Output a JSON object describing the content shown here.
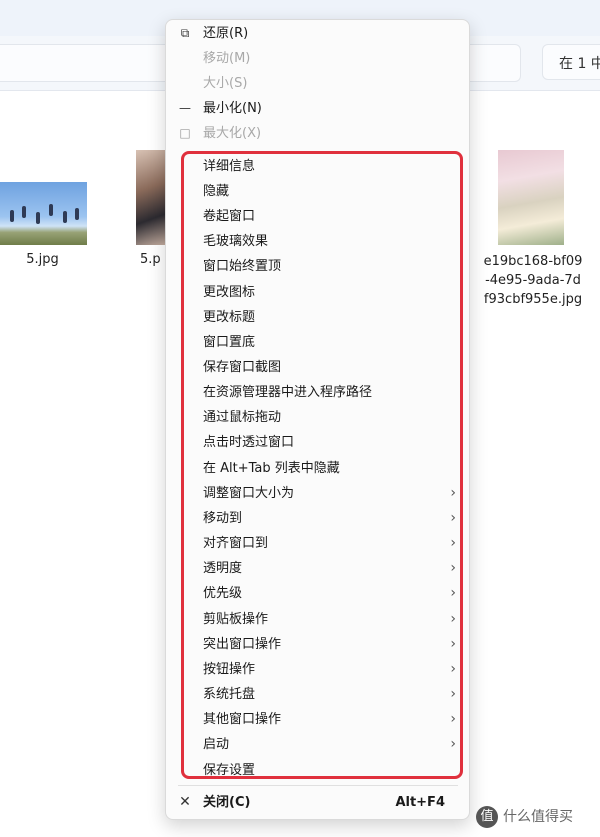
{
  "search": {
    "text": "在 1 中"
  },
  "files": [
    {
      "name": "5.jpg"
    },
    {
      "name": "5.p"
    },
    {
      "name": "e19bc168-bf09-4e95-9ada-7df93cbf955e.jpg",
      "lines": [
        "e19bc168-bf09",
        "-4e95-9ada-7d",
        "f93cbf955e.jpg"
      ]
    }
  ],
  "menu": {
    "system_items": [
      {
        "label": "还原(R)",
        "icon": "restore-icon",
        "disabled": false
      },
      {
        "label": "移动(M)",
        "disabled": true
      },
      {
        "label": "大小(S)",
        "disabled": true
      },
      {
        "label": "最小化(N)",
        "icon": "minimize-icon",
        "disabled": false
      },
      {
        "label": "最大化(X)",
        "icon": "maximize-icon",
        "disabled": true
      }
    ],
    "custom_items": [
      {
        "label": "详细信息"
      },
      {
        "label": "隐藏"
      },
      {
        "label": "卷起窗口"
      },
      {
        "label": "毛玻璃效果"
      },
      {
        "label": "窗口始终置顶"
      },
      {
        "label": "更改图标"
      },
      {
        "label": "更改标题"
      },
      {
        "label": "窗口置底"
      },
      {
        "label": "保存窗口截图"
      },
      {
        "label": "在资源管理器中进入程序路径"
      },
      {
        "label": "通过鼠标拖动"
      },
      {
        "label": "点击时透过窗口"
      },
      {
        "label": "在 Alt+Tab 列表中隐藏"
      },
      {
        "label": "调整窗口大小为",
        "submenu": true
      },
      {
        "label": "移动到",
        "submenu": true
      },
      {
        "label": "对齐窗口到",
        "submenu": true
      },
      {
        "label": "透明度",
        "submenu": true
      },
      {
        "label": "优先级",
        "submenu": true
      },
      {
        "label": "剪贴板操作",
        "submenu": true
      },
      {
        "label": "突出窗口操作",
        "submenu": true
      },
      {
        "label": "按钮操作",
        "submenu": true
      },
      {
        "label": "系统托盘",
        "submenu": true
      },
      {
        "label": "其他窗口操作",
        "submenu": true
      },
      {
        "label": "启动",
        "submenu": true
      },
      {
        "label": "保存设置"
      }
    ],
    "close": {
      "label": "关闭(C)",
      "shortcut": "Alt+F4",
      "icon": "close-icon"
    }
  },
  "watermark": {
    "text": "什么值得买",
    "logo": "值"
  },
  "colors": {
    "highlight": "#e0303d",
    "menu_bg": "#fbfbfb"
  }
}
